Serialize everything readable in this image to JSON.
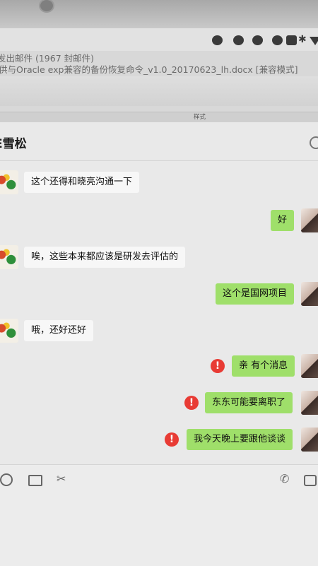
{
  "background_window": {
    "mail_line": "发出邮件 (1967 封邮件)",
    "doc_line": "供与Oracle exp兼容的备份恢复命令_v1.0_20170623_lh.docx [兼容模式]",
    "style_label": "样式"
  },
  "chat": {
    "title": "E雪松",
    "messages": [
      {
        "side": "in",
        "text": "这个还得和晓亮沟通一下"
      },
      {
        "side": "out",
        "text": "好"
      },
      {
        "side": "in",
        "text": "唉，这些本来都应该是研发去评估的"
      },
      {
        "side": "out",
        "text": "这个是国网项目"
      },
      {
        "side": "in",
        "text": "哦，还好还好"
      },
      {
        "side": "out",
        "text": "亲 有个消息",
        "failed": true
      },
      {
        "side": "out",
        "text": "东东可能要离职了",
        "failed": true
      },
      {
        "side": "out",
        "text": "我今天晚上要跟他谈谈",
        "failed": true
      }
    ],
    "error_glyph": "!",
    "toolbar": {
      "emoji_icon": "emoji-icon",
      "folder_icon": "folder-icon",
      "scissors_glyph": "✂",
      "phone_glyph": "✆"
    }
  },
  "colors": {
    "outgoing_bubble": "#9fdf6a",
    "incoming_bubble": "#f7f7f7",
    "error_badge": "#e83b34"
  }
}
